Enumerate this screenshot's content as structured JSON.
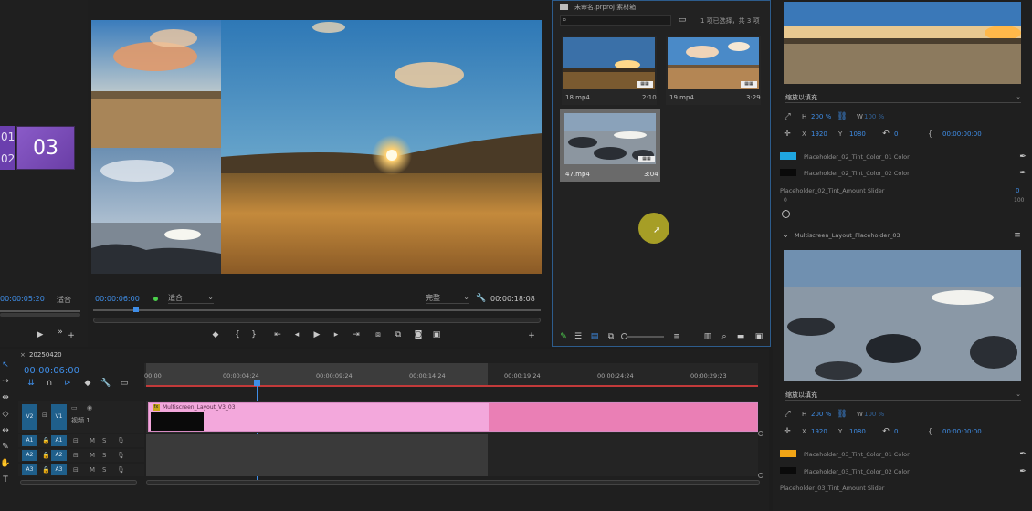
{
  "left_panel": {
    "tile_a_label": "01",
    "tile_b_label": "02",
    "tile_big_label": "03",
    "timecode": "00:00:05:20",
    "fit_label": "适合"
  },
  "program_monitor": {
    "timecode": "00:00:06:00",
    "fit_dropdown": "适合",
    "quality_dropdown": "完整",
    "duration": "00:00:18:08"
  },
  "project_panel": {
    "title": "未命名.prproj 素材箱",
    "search_placeholder": "",
    "selection_status": "1 项已选择，共 3 项",
    "clips": [
      {
        "name": "18.mp4",
        "duration": "2:10"
      },
      {
        "name": "19.mp4",
        "duration": "3:29"
      },
      {
        "name": "47.mp4",
        "duration": "3:04"
      }
    ]
  },
  "timeline": {
    "sequence_name": "20250420",
    "timecode": "00:00:06:00",
    "ruler_labels": [
      "00:00",
      "00:00:04:24",
      "00:00:09:24",
      "00:00:14:24",
      "00:00:19:24",
      "00:00:24:24",
      "00:00:29:23"
    ],
    "tracks": {
      "video": [
        {
          "src": "V2",
          "dst": "V1",
          "name": "视频 1"
        }
      ],
      "audio": [
        {
          "src": "A1",
          "dst": "A1"
        },
        {
          "src": "A2",
          "dst": "A2"
        },
        {
          "src": "A3",
          "dst": "A3"
        }
      ]
    },
    "clip_name": "Multiscreen_Layout_V3_03"
  },
  "effect_controls": {
    "section1": {
      "dropdown": "缩放以填充",
      "h_label": "H",
      "h_value": "200 %",
      "w_label": "W",
      "w_value": "100 %",
      "x_label": "X",
      "x_value": "1920",
      "y_label": "Y",
      "y_value": "1080",
      "rotation": "0",
      "anchor": "00:00:00:00",
      "color1_label": "Placeholder_02_Tint_Color_01 Color",
      "color2_label": "Placeholder_02_Tint_Color_02 Color",
      "slider_label": "Placeholder_02_Tint_Amount Slider",
      "slider_value": "0",
      "slider_min": "0",
      "slider_max": "100",
      "slider_position": 0
    },
    "layer_name": "Multiscreen_Layout_Placeholder_03",
    "section2": {
      "dropdown": "缩放以填充",
      "h_label": "H",
      "h_value": "200 %",
      "w_label": "W",
      "w_value": "100 %",
      "x_label": "X",
      "x_value": "1920",
      "y_label": "Y",
      "y_value": "1080",
      "rotation": "0",
      "anchor": "00:00:00:00",
      "color1_label": "Placeholder_03_Tint_Color_01 Color",
      "color2_label": "Placeholder_03_Tint_Color_02 Color",
      "slider_label": "Placeholder_03_Tint_Amount Slider"
    }
  },
  "colors": {
    "accent": "#3f8ee8",
    "tint1_sec1": "#1fa6e0",
    "tint2_sec1": "#0a0a0a",
    "tint1_sec2": "#f2a516",
    "tint2_sec2": "#0a0a0a",
    "clip_pink": "#f3a8dc",
    "clip_pink_dark": "#ea7fb5",
    "playhead": "#3f8ee8",
    "tile_purple": "#7a4bb8"
  }
}
